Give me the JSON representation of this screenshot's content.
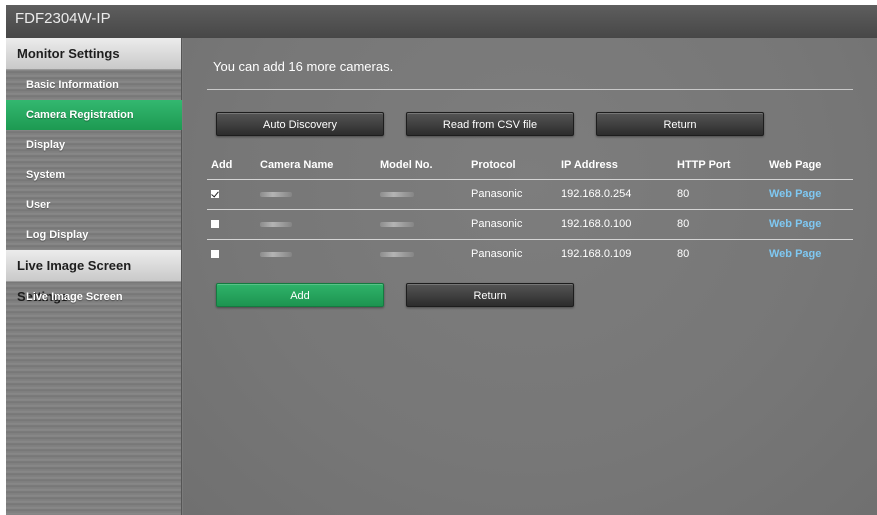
{
  "window": {
    "title": "FDF2304W-IP"
  },
  "sidebar": {
    "monitor_settings_header": "Monitor Settings",
    "items": [
      {
        "label": "Basic Information",
        "active": false
      },
      {
        "label": "Camera Registration",
        "active": true
      },
      {
        "label": "Display",
        "active": false
      },
      {
        "label": "System",
        "active": false
      },
      {
        "label": "User",
        "active": false
      },
      {
        "label": "Log Display",
        "active": false
      }
    ],
    "live_header": "Live Image Screen Settings",
    "live_items": [
      {
        "label": "Live Image Screen"
      }
    ]
  },
  "main": {
    "info_text": "You can add 16 more cameras.",
    "top_buttons": {
      "auto_discovery": "Auto Discovery",
      "read_csv": "Read from CSV file",
      "return": "Return"
    },
    "table": {
      "columns": [
        "Add",
        "Camera Name",
        "Model No.",
        "Protocol",
        "IP Address",
        "HTTP Port",
        "Web Page"
      ],
      "rows": [
        {
          "checked": true,
          "protocol": "Panasonic",
          "ip": "192.168.0.254",
          "port": "80",
          "web": "Web Page"
        },
        {
          "checked": false,
          "protocol": "Panasonic",
          "ip": "192.168.0.100",
          "port": "80",
          "web": "Web Page"
        },
        {
          "checked": false,
          "protocol": "Panasonic",
          "ip": "192.168.0.109",
          "port": "80",
          "web": "Web Page"
        }
      ]
    },
    "bottom_buttons": {
      "add": "Add",
      "return": "Return"
    }
  },
  "colors": {
    "accent_green": "#1d9a52",
    "link_blue": "#7fc8f2",
    "background_gray": "#7b7b7b"
  }
}
